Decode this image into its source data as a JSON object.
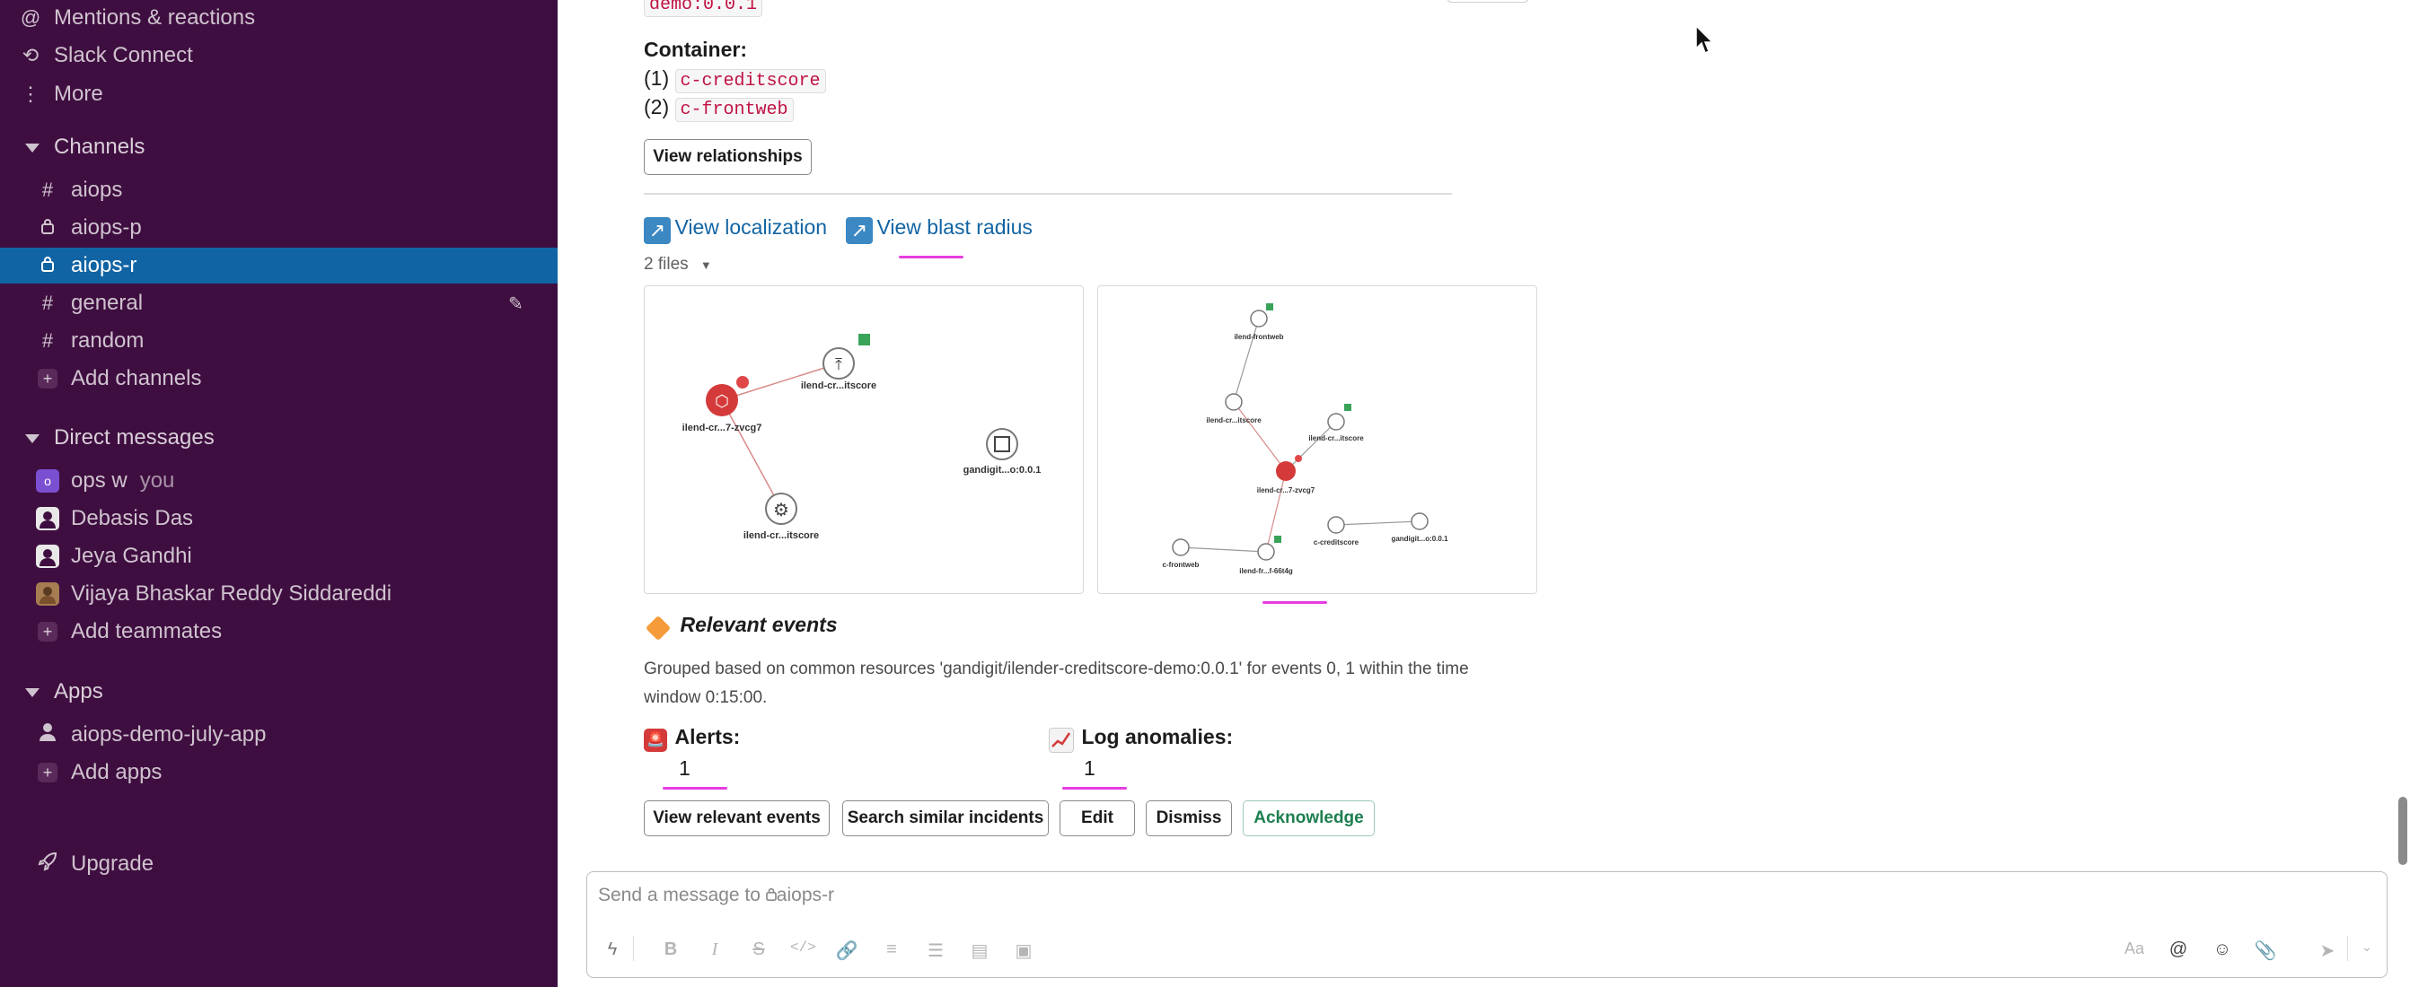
{
  "sidebar": {
    "top_items": [
      {
        "icon": "at-icon",
        "glyph": "@",
        "label": "Mentions & reactions"
      },
      {
        "icon": "slack-connect-icon",
        "glyph": "⟲",
        "label": "Slack Connect"
      },
      {
        "icon": "more-vertical-icon",
        "glyph": "⋮",
        "label": "More"
      }
    ],
    "channels_header": "Channels",
    "channels": [
      {
        "icon": "hash-icon",
        "glyph": "#",
        "name": "aiops",
        "active": false
      },
      {
        "icon": "lock-icon",
        "glyph": "🔒",
        "name": "aiops-p",
        "active": false
      },
      {
        "icon": "lock-icon",
        "glyph": "🔒",
        "name": "aiops-r",
        "active": true
      },
      {
        "icon": "hash-icon",
        "glyph": "#",
        "name": "general",
        "active": false
      },
      {
        "icon": "hash-icon",
        "glyph": "#",
        "name": "random",
        "active": false
      }
    ],
    "add_channels": "Add channels",
    "dm_header": "Direct messages",
    "dms": [
      {
        "name": "ops w",
        "suffix": "you",
        "avatar_color": "#7b4fd1"
      },
      {
        "name": "Debasis Das",
        "suffix": "",
        "avatar_color": "#e8e8e8"
      },
      {
        "name": "Jeya Gandhi",
        "suffix": "",
        "avatar_color": "#e8e8e8"
      },
      {
        "name": "Vijaya Bhaskar Reddy Siddareddi",
        "suffix": "",
        "avatar_color": "#a67c52"
      }
    ],
    "add_teammates": "Add teammates",
    "apps_header": "Apps",
    "apps": [
      {
        "name": "aiops-demo-july-app"
      }
    ],
    "add_apps": "Add apps",
    "upgrade": "Upgrade"
  },
  "message": {
    "top_tag": "demo:0.0.1",
    "container_label": "Container:",
    "containers": [
      {
        "index": "(1)",
        "name": "c-creditscore"
      },
      {
        "index": "(2)",
        "name": "c-frontweb"
      }
    ],
    "view_relationships": "View relationships",
    "view_localization": "View localization",
    "view_blast_radius": "View blast radius",
    "files_toggle": "2 files",
    "thumb1_labels": [
      "ilend-cr...itscore",
      "ilend-cr...7-zvcg7",
      "gandigit...o:0.0.1",
      "ilend-cr...itscore"
    ],
    "thumb2_labels": [
      "ilend-frontweb",
      "ilend-cr...itscore",
      "ilend-cr...itscore",
      "ilend-cr...7-zvcg7",
      "c-creditscore",
      "gandigit...o:0.0.1",
      "c-frontweb",
      "ilend-fr...f-66t4g"
    ],
    "relevant_title": "Relevant events",
    "relevant_desc": "Grouped based on common resources 'gandigit/ilender-creditscore-demo:0.0.1' for events 0, 1 within the time window 0:15:00.",
    "alerts_label": "Alerts:",
    "alerts_count": "1",
    "log_label": "Log anomalies:",
    "log_count": "1",
    "buttons": {
      "view_relevant": "View relevant events",
      "search_similar": "Search similar incidents",
      "edit": "Edit",
      "dismiss": "Dismiss",
      "acknowledge": "Acknowledge"
    }
  },
  "composer": {
    "placeholder_prefix": "Send a message to",
    "channel": "aiops-r",
    "font_toggle": "Aa"
  },
  "colors": {
    "sidebar_bg": "#3f0e40",
    "active_bg": "#1164a3",
    "code_red": "#c01343",
    "link_blue": "#1264a3",
    "acknowledge_green": "#1d7f4f",
    "highlight_pink": "#e63de0"
  }
}
